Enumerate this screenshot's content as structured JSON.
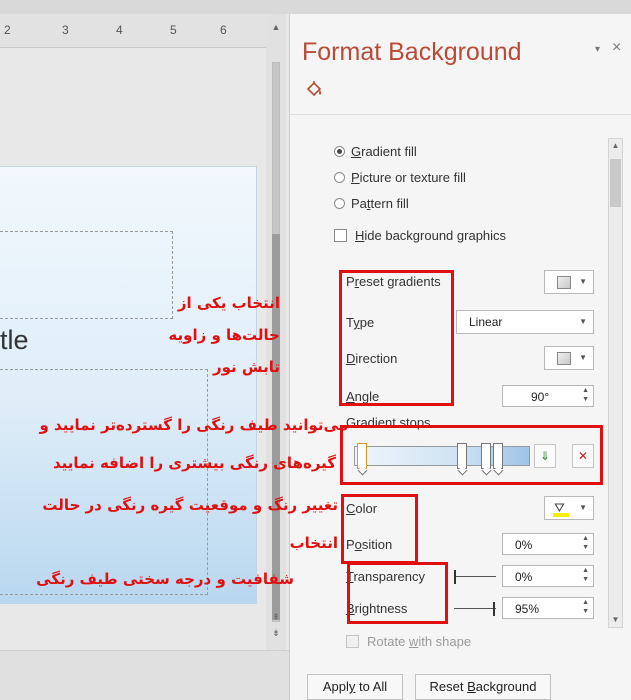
{
  "ruler": {
    "numbers": [
      "2",
      "3",
      "4",
      "5",
      "6"
    ]
  },
  "slide": {
    "text_fragment": "tle"
  },
  "pane": {
    "title": "Format Background",
    "menu_arrow": "▾",
    "close": "×",
    "fill_options": [
      {
        "pre": "",
        "key": "G",
        "rest": "radient fill",
        "selected": true
      },
      {
        "pre": "",
        "key": "P",
        "rest": "icture or texture fill",
        "selected": false
      },
      {
        "pre": "Pa",
        "key": "t",
        "rest": "tern fill",
        "selected": false
      }
    ],
    "hide_graphics": {
      "pre": "",
      "key": "H",
      "rest": "ide background graphics"
    },
    "preset_gradients": {
      "pre": "P",
      "key": "r",
      "rest": "eset gradients"
    },
    "type": {
      "pre": "T",
      "key": "y",
      "rest": "pe",
      "value": "Linear"
    },
    "direction": {
      "pre": "",
      "key": "D",
      "rest": "irection"
    },
    "angle": {
      "pre": "",
      "key": "A",
      "rest": "ngle",
      "value": "90°"
    },
    "gradient_stops": {
      "label": "Gradient stops"
    },
    "color": {
      "pre": "",
      "key": "C",
      "rest": "olor"
    },
    "position": {
      "pre": "P",
      "key": "o",
      "rest": "sition",
      "value": "0%"
    },
    "transparency": {
      "pre": "",
      "key": "T",
      "rest": "ransparency",
      "value": "0%"
    },
    "brightness": {
      "pre": "",
      "key": "B",
      "rest": "rightness",
      "value": "95%"
    },
    "rotate_with_shape": {
      "pre": "Rotate ",
      "key": "w",
      "rest": "ith shape"
    },
    "apply_all": {
      "pre": "Appl",
      "key": "y",
      "rest": " to All"
    },
    "reset": {
      "pre": "Reset ",
      "key": "B",
      "rest": "ackground"
    }
  },
  "annotations": {
    "note1": [
      "انتخاب یکی از",
      "حالت‌ها و زاویه",
      "تابش نور"
    ],
    "note2": [
      "می‌توانید طیف رنگی را گسترده‌تر نمایید و",
      "گیره‌های رنگی بیشتری را اضافه نمایید"
    ],
    "note3": [
      "تغییر رنگ و موقعیت گیره رنگی در حالت",
      "انتخاب"
    ],
    "note4": [
      "شفافیت و درجه سختی طیف رنگی"
    ]
  },
  "colors": {
    "title": "#b94a36",
    "annotation": "#e01010"
  }
}
